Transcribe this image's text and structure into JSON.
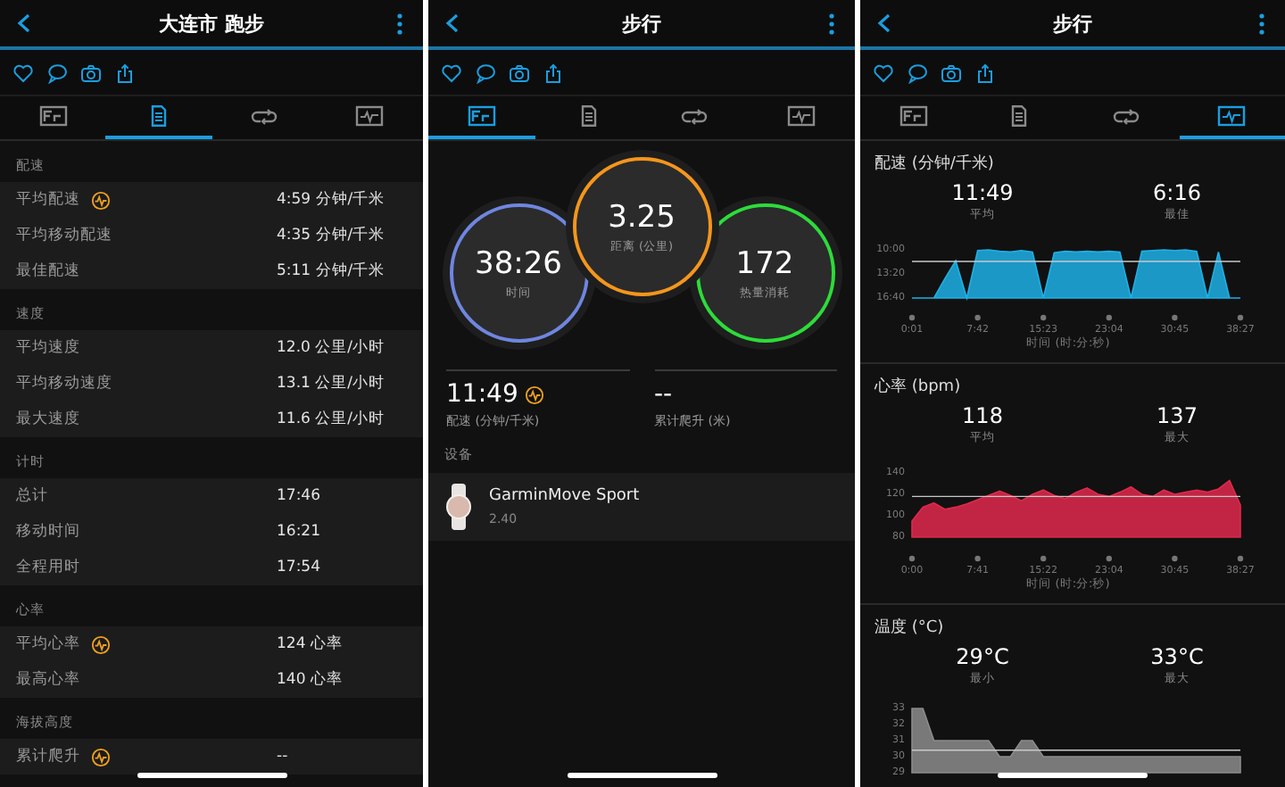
{
  "panels": [
    {
      "kind": "details",
      "title": "大连市 跑步",
      "tabs": [
        {
          "selected": false
        },
        {
          "selected": true
        },
        {
          "selected": false
        },
        {
          "selected": false
        }
      ],
      "sections": [
        {
          "title": "配速",
          "rows": [
            {
              "label": "平均配速",
              "value": "4:59 分钟/千米",
              "insight": true
            },
            {
              "label": "平均移动配速",
              "value": "4:35 分钟/千米",
              "insight": false
            },
            {
              "label": "最佳配速",
              "value": "5:11 分钟/千米",
              "insight": false
            }
          ]
        },
        {
          "title": "速度",
          "rows": [
            {
              "label": "平均速度",
              "value": "12.0 公里/小时",
              "insight": false
            },
            {
              "label": "平均移动速度",
              "value": "13.1 公里/小时",
              "insight": false
            },
            {
              "label": "最大速度",
              "value": "11.6 公里/小时",
              "insight": false
            }
          ]
        },
        {
          "title": "计时",
          "rows": [
            {
              "label": "总计",
              "value": "17:46",
              "insight": false
            },
            {
              "label": "移动时间",
              "value": "16:21",
              "insight": false
            },
            {
              "label": "全程用时",
              "value": "17:54",
              "insight": false
            }
          ]
        },
        {
          "title": "心率",
          "rows": [
            {
              "label": "平均心率",
              "value": "124 心率",
              "insight": true
            },
            {
              "label": "最高心率",
              "value": "140 心率",
              "insight": false
            }
          ]
        },
        {
          "title": "海拔高度",
          "rows": [
            {
              "label": "累计爬升",
              "value": "--",
              "insight": true
            }
          ]
        }
      ]
    },
    {
      "kind": "summary",
      "title": "步行",
      "tabs": [
        {
          "selected": true
        },
        {
          "selected": false
        },
        {
          "selected": false
        },
        {
          "selected": false
        }
      ],
      "rings": [
        {
          "value": "38:26",
          "label": "时间",
          "color": "#6f86e0"
        },
        {
          "value": "3.25",
          "label": "距离 (公里)",
          "color": "#f5961c"
        },
        {
          "value": "172",
          "label": "热量消耗",
          "color": "#2cdc3a"
        }
      ],
      "stats": [
        {
          "value": "11:49",
          "label": "配速 (分钟/千米)",
          "insight": true
        },
        {
          "value": "--",
          "label": "累计爬升 (米)",
          "insight": false
        }
      ],
      "device_heading": "设备",
      "device": {
        "name": "GarminMove Sport",
        "version": "2.40"
      }
    },
    {
      "kind": "charts",
      "title": "步行",
      "tabs": [
        {
          "selected": false
        },
        {
          "selected": false
        },
        {
          "selected": false
        },
        {
          "selected": true
        }
      ],
      "charts": [
        {
          "title": "配速 (分钟/千米)",
          "stats": [
            {
              "value": "11:49",
              "label": "平均"
            },
            {
              "value": "6:16",
              "label": "最佳"
            }
          ],
          "chart_data": {
            "type": "area",
            "xlabel": "时间 (时:分:秒)",
            "categories": [
              "0:01",
              null,
              null,
              null,
              null,
              null,
              "7:42",
              null,
              null,
              null,
              null,
              null,
              "15:23",
              null,
              null,
              null,
              null,
              null,
              "23:04",
              null,
              null,
              null,
              null,
              null,
              "30:45",
              null,
              null,
              null,
              null,
              null,
              "38:27"
            ],
            "series": [
              {
                "color": "#1fb0e6",
                "values": [
                  16.67,
                  16.67,
                  16.67,
                  14,
                  11.5,
                  16.67,
                  10.1,
                  10,
                  10.2,
                  10.3,
                  10.1,
                  10.3,
                  16.67,
                  10.4,
                  10.2,
                  10.3,
                  10.2,
                  10.3,
                  10.2,
                  10.3,
                  16.67,
                  10.2,
                  10.1,
                  10,
                  10.1,
                  10,
                  10.2,
                  16.67,
                  10.3,
                  16.67,
                  16.67
                ]
              }
            ],
            "ylim": [
              16.67,
              10
            ],
            "yticks": [
              {
                "value": 10,
                "label": "10:00"
              },
              {
                "value": 13.33,
                "label": "13:20"
              },
              {
                "value": 16.67,
                "label": "16:40"
              }
            ],
            "ref_lines": [
              {
                "axis": "y",
                "value": 11.6
              }
            ]
          }
        },
        {
          "title": "心率 (bpm)",
          "stats": [
            {
              "value": "118",
              "label": "平均"
            },
            {
              "value": "137",
              "label": "最大"
            }
          ],
          "chart_data": {
            "type": "area",
            "xlabel": "时间 (时:分:秒)",
            "categories": [
              "0:00",
              null,
              null,
              null,
              null,
              null,
              "7:41",
              null,
              null,
              null,
              null,
              null,
              "15:22",
              null,
              null,
              null,
              null,
              null,
              "23:04",
              null,
              null,
              null,
              null,
              null,
              "30:45",
              null,
              null,
              null,
              null,
              null,
              "38:27"
            ],
            "series": [
              {
                "color": "#e0294c",
                "values": [
                  95,
                  108,
                  112,
                  106,
                  108,
                  111,
                  115,
                  119,
                  123,
                  119,
                  114,
                  120,
                  124,
                  119,
                  116,
                  122,
                  126,
                  120,
                  118,
                  122,
                  127,
                  120,
                  118,
                  124,
                  120,
                  122,
                  124,
                  122,
                  125,
                  133,
                  110
                ]
              }
            ],
            "ylim": [
              80,
              140
            ],
            "yticks": [
              80,
              100,
              120,
              140
            ],
            "ref_lines": [
              {
                "axis": "y",
                "value": 118
              }
            ]
          }
        },
        {
          "title": "温度 (°C)",
          "stats": [
            {
              "value": "29°C",
              "label": "最小"
            },
            {
              "value": "33°C",
              "label": "最大"
            }
          ],
          "chart_data": {
            "type": "area",
            "series": [
              {
                "color": "#8c8c8c",
                "values": [
                  33,
                  33,
                  31,
                  31,
                  31,
                  31,
                  31,
                  31,
                  30,
                  30,
                  31,
                  31,
                  30,
                  30,
                  30,
                  30,
                  30,
                  30,
                  30,
                  30,
                  30,
                  30,
                  30,
                  30,
                  30,
                  30,
                  30,
                  30,
                  30,
                  30,
                  30
                ]
              }
            ],
            "ylim": [
              29,
              33
            ],
            "yticks": [
              29,
              30,
              31,
              32,
              33
            ],
            "ref_lines": [
              {
                "axis": "y",
                "value": 30.4
              }
            ]
          }
        }
      ]
    }
  ]
}
